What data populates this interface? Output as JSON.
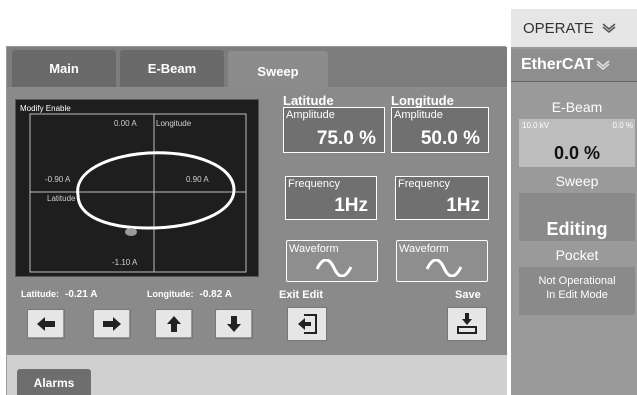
{
  "tabs": {
    "main": "Main",
    "ebeam": "E-Beam",
    "sweep": "Sweep"
  },
  "plot": {
    "modify_enable": "Modify Enable",
    "top_label": "0.00 A",
    "longitude_label": "Longitude",
    "left_label": "-0.90 A",
    "right_label": "0.90 A",
    "latitude_label": "Latitude",
    "bottom_label": "-1.10 A"
  },
  "readouts": {
    "latitude_label": "Latitude:",
    "latitude_value": "-0.21 A",
    "longitude_label": "Longitude:",
    "longitude_value": "-0.82 A"
  },
  "latitude": {
    "header": "Latitude",
    "amplitude_label": "Amplitude",
    "amplitude_value": "75.0 %",
    "frequency_label": "Frequency",
    "frequency_value": "1Hz",
    "waveform_label": "Waveform"
  },
  "longitude": {
    "header": "Longitude",
    "amplitude_label": "Amplitude",
    "amplitude_value": "50.0 %",
    "frequency_label": "Frequency",
    "frequency_value": "1Hz",
    "waveform_label": "Waveform"
  },
  "edit": {
    "exit_label": "Exit Edit",
    "save_label": "Save"
  },
  "footer": {
    "alarms": "Alarms"
  },
  "sidebar": {
    "operate": "OPERATE",
    "ethercat": "EtherCAT",
    "ebeam_title": "E-Beam",
    "ebeam_kv": "10.0 kV",
    "ebeam_pct_small": "0.0 %",
    "ebeam_value": "0.0 %",
    "sweep_title": "Sweep",
    "sweep_status": "Editing",
    "pocket_title": "Pocket",
    "pocket_status_line1": "Not Operational",
    "pocket_status_line2": "In Edit Mode"
  },
  "icons": [
    "arrow-left-icon",
    "arrow-right-icon",
    "arrow-up-icon",
    "arrow-down-icon",
    "exit-edit-icon",
    "save-icon",
    "sine-wave-icon",
    "chevron-down-icon"
  ]
}
